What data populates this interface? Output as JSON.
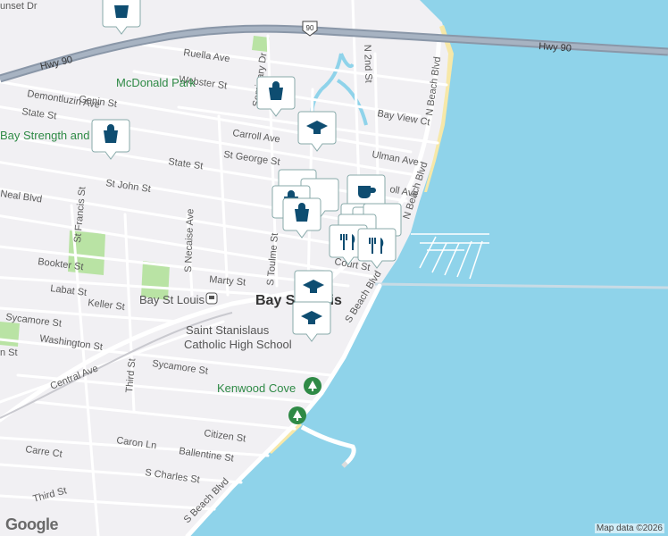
{
  "colors": {
    "water": "#8fd3ea",
    "land": "#f1f0f3",
    "road": "#ffffff",
    "highway": "#7f8ea0",
    "park": "#b9e3a4",
    "marker": "#0e4d71",
    "beach": "#f7e8a8"
  },
  "highways": {
    "route_label": "Hwy 90",
    "shield_number": "90"
  },
  "streets": {
    "sunset": "unset Dr",
    "ruella": "Ruella Ave",
    "webster": "Webster St",
    "seminary": "Seminary Dr",
    "n2nd": "N 2nd St",
    "genin": "Genin St",
    "demontluzin": "Demontluzin Ave",
    "state_top": "State St",
    "bayview": "Bay View Ct",
    "carroll": "Carroll Ave",
    "stgeorge": "St George St",
    "ulman": "Ulman Ave",
    "state": "State St",
    "stjohn": "St John St",
    "neal": "Neal Blvd",
    "stfrancis": "St Francis St",
    "necaise": "S Necaise Ave",
    "stoulme": "S Toulme St",
    "bookter": "Bookter St",
    "marty": "Marty St",
    "labat": "Labat St",
    "keller": "Keller St",
    "sycamore_w": "Sycamore St",
    "washington": "Washington St",
    "central": "Central Ave",
    "third": "Third St",
    "sycamore": "Sycamore St",
    "citizen": "Citizen St",
    "caron": "Caron Ln",
    "ballentine": "Ballentine St",
    "carre": "Carre Ct",
    "stcharles": "S Charles St",
    "third_sw": "Third St",
    "sbeach": "S Beach Blvd",
    "sbeach2": "S Beach Blvd",
    "nbeach": "N Beach Blvd",
    "nbeach2": "N Beach Blvd",
    "court": "Court St",
    "carroll_ave2": "oll Ave",
    "partial_n": "n St"
  },
  "places": {
    "mcdonald_park": "McDonald Park",
    "bay_strength": "Bay Strength and Fitness",
    "bay_st_louis_station": "Bay St Louis",
    "city": "Bay St Louis",
    "school": "Saint Stanislaus Catholic High School",
    "school_line2": "Catholic High School",
    "school_line1": "Saint Stanislaus",
    "kenwood": "Kenwood Cove"
  },
  "attribution": "Map data ©2026",
  "logo": "Google",
  "markers": [
    {
      "kind": "shopping",
      "icon": "shopping-bag-icon"
    },
    {
      "kind": "shopping",
      "icon": "shopping-bag-icon"
    },
    {
      "kind": "school",
      "icon": "graduation-cap-icon"
    },
    {
      "kind": "shopping",
      "icon": "shopping-bag-icon"
    },
    {
      "kind": "cafe",
      "icon": "coffee-cup-icon"
    },
    {
      "kind": "restaurant",
      "icon": "fork-knife-icon"
    },
    {
      "kind": "restaurant",
      "icon": "fork-knife-icon"
    },
    {
      "kind": "school",
      "icon": "graduation-cap-icon"
    },
    {
      "kind": "school",
      "icon": "graduation-cap-icon"
    },
    {
      "kind": "park",
      "icon": "tree-icon"
    },
    {
      "kind": "park",
      "icon": "tree-icon"
    }
  ]
}
